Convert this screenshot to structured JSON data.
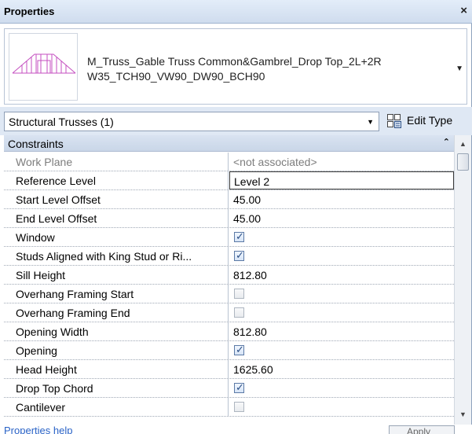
{
  "panel": {
    "title": "Properties",
    "close_glyph": "×"
  },
  "type_selector": {
    "name_line1": "M_Truss_Gable Truss Common&Gambrel_Drop Top_2L+2R",
    "name_line2": "W35_TCH90_VW90_DW90_BCH90",
    "preview_icon": "truss-preview-icon",
    "dropdown_glyph": "▼"
  },
  "instance_selector": {
    "value": "Structural Trusses (1)",
    "arrow_glyph": "▼"
  },
  "edit_type": {
    "label": "Edit Type",
    "icon": "edit-type-icon"
  },
  "category": {
    "label": "Constraints",
    "collapse_glyph": "⌃"
  },
  "rows": [
    {
      "name": "Work Plane",
      "value": "<not associated>",
      "kind": "text",
      "grey": true
    },
    {
      "name": "Reference Level",
      "value": "Level 2",
      "kind": "edit"
    },
    {
      "name": "Start Level Offset",
      "value": "45.00",
      "kind": "text"
    },
    {
      "name": "End Level Offset",
      "value": "45.00",
      "kind": "text"
    },
    {
      "name": "Window",
      "value": "",
      "kind": "check",
      "checked": true
    },
    {
      "name": "Studs Aligned with King Stud or Ri...",
      "value": "",
      "kind": "check",
      "checked": true
    },
    {
      "name": "Sill Height",
      "value": "812.80",
      "kind": "text"
    },
    {
      "name": "Overhang Framing Start",
      "value": "",
      "kind": "check",
      "checked": false
    },
    {
      "name": "Overhang Framing End",
      "value": "",
      "kind": "check",
      "checked": false
    },
    {
      "name": "Opening Width",
      "value": "812.80",
      "kind": "text"
    },
    {
      "name": "Opening",
      "value": "",
      "kind": "check",
      "checked": true
    },
    {
      "name": "Head Height",
      "value": "1625.60",
      "kind": "text"
    },
    {
      "name": "Drop Top Chord",
      "value": "",
      "kind": "check",
      "checked": true
    },
    {
      "name": "Cantilever",
      "value": "",
      "kind": "check",
      "checked": false
    }
  ],
  "scrollbar": {
    "up_glyph": "▲",
    "down_glyph": "▼"
  },
  "footer": {
    "help_link": "Properties help",
    "apply_label": "Apply"
  },
  "colors": {
    "title_bar": "#cfdcee",
    "link": "#2a63c7",
    "checkbox_check": "#2b4f85"
  }
}
